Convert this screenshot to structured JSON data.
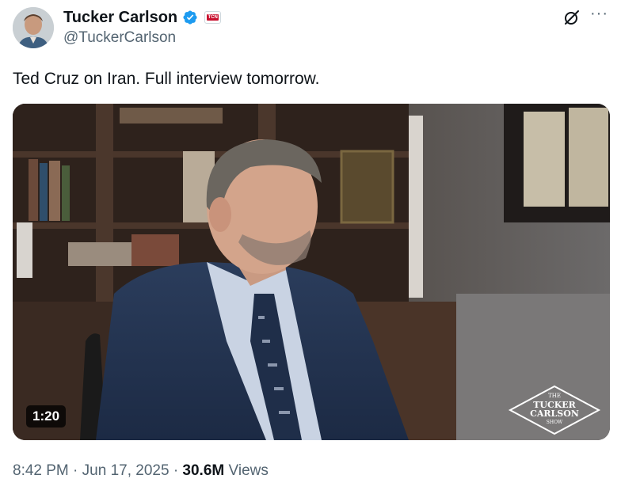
{
  "author": {
    "display_name": "Tucker Carlson",
    "handle": "@TuckerCarlson",
    "affiliate_badge": "TCN"
  },
  "icons": {
    "verified": "verified-badge-icon",
    "grok": "grok-icon",
    "more": "more-icon"
  },
  "tweet": {
    "text": "Ted Cruz on Iran. Full interview tomorrow."
  },
  "video": {
    "duration": "1:20",
    "logo_line1": "THE",
    "logo_line2": "TUCKER",
    "logo_line3": "CARLSON",
    "logo_line4": "SHOW"
  },
  "meta": {
    "time": "8:42 PM",
    "separator": "·",
    "date": "Jun 17, 2025",
    "views_count": "30.6M",
    "views_label": "Views"
  },
  "colors": {
    "verified_blue": "#1d9bf0",
    "secondary_text": "#536471",
    "primary_text": "#0f1419"
  }
}
